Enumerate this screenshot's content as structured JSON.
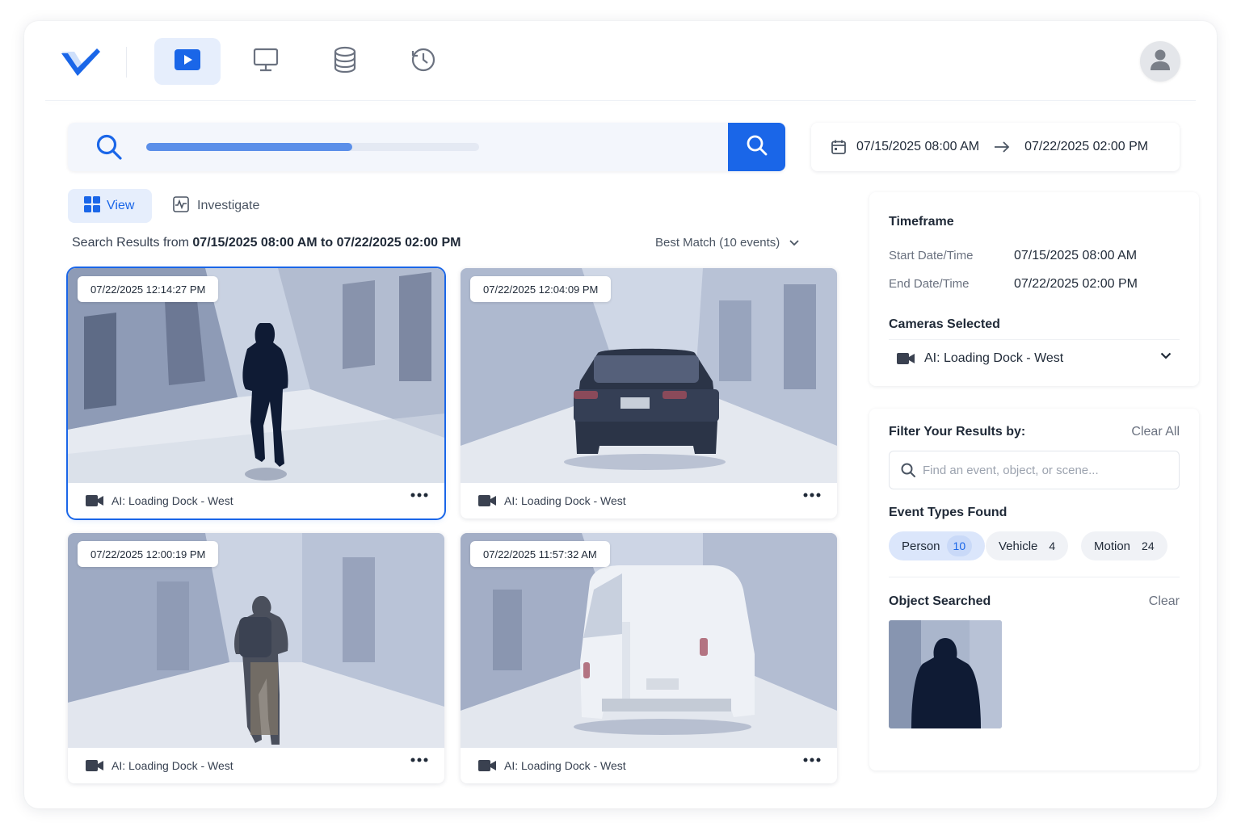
{
  "nav": {
    "items": [
      {
        "name": "video",
        "icon": "play-icon",
        "active": true
      },
      {
        "name": "monitor",
        "icon": "monitor-icon",
        "active": false
      },
      {
        "name": "storage",
        "icon": "database-icon",
        "active": false
      },
      {
        "name": "history",
        "icon": "clock-icon",
        "active": false
      }
    ],
    "avatar_icon": "user-icon"
  },
  "search": {
    "progress": 0.62,
    "button_icon": "search-icon"
  },
  "daterange": {
    "start": "07/15/2025 08:00 AM",
    "end": "07/22/2025 02:00 PM"
  },
  "tabs": {
    "view": "View",
    "investigate": "Investigate"
  },
  "results": {
    "prefix": "Search Results from ",
    "range": "07/15/2025 08:00 AM to 07/22/2025 02:00 PM",
    "sort_label": "Best Match (10 events)"
  },
  "cards": [
    {
      "timestamp": "07/22/2025 12:14:27 PM",
      "camera": "AI: Loading Dock - West",
      "selected": true
    },
    {
      "timestamp": "07/22/2025 12:04:09 PM",
      "camera": "AI: Loading Dock - West",
      "selected": false
    },
    {
      "timestamp": "07/22/2025 12:00:19 PM",
      "camera": "AI: Loading Dock - West",
      "selected": false
    },
    {
      "timestamp": "07/22/2025 11:57:32 AM",
      "camera": "AI: Loading Dock - West",
      "selected": false
    }
  ],
  "timeframe": {
    "title": "Timeframe",
    "start_label": "Start Date/Time",
    "start_value": "07/15/2025 08:00 AM",
    "end_label": "End Date/Time",
    "end_value": "07/22/2025 02:00 PM",
    "cameras_title": "Cameras Selected",
    "camera": "AI: Loading Dock - West"
  },
  "filters": {
    "title": "Filter Your Results by:",
    "clear_all": "Clear All",
    "placeholder": "Find an event, object, or scene...",
    "event_types_title": "Event Types Found",
    "event_types": [
      {
        "label": "Person",
        "count": "10"
      },
      {
        "label": "Vehicle",
        "count": "4"
      },
      {
        "label": "Motion",
        "count": "24"
      }
    ],
    "object_title": "Object Searched",
    "object_clear": "Clear"
  },
  "colors": {
    "accent": "#1a66e8",
    "accent_light": "#e6eefc",
    "nav_icon": "#6b7280"
  }
}
